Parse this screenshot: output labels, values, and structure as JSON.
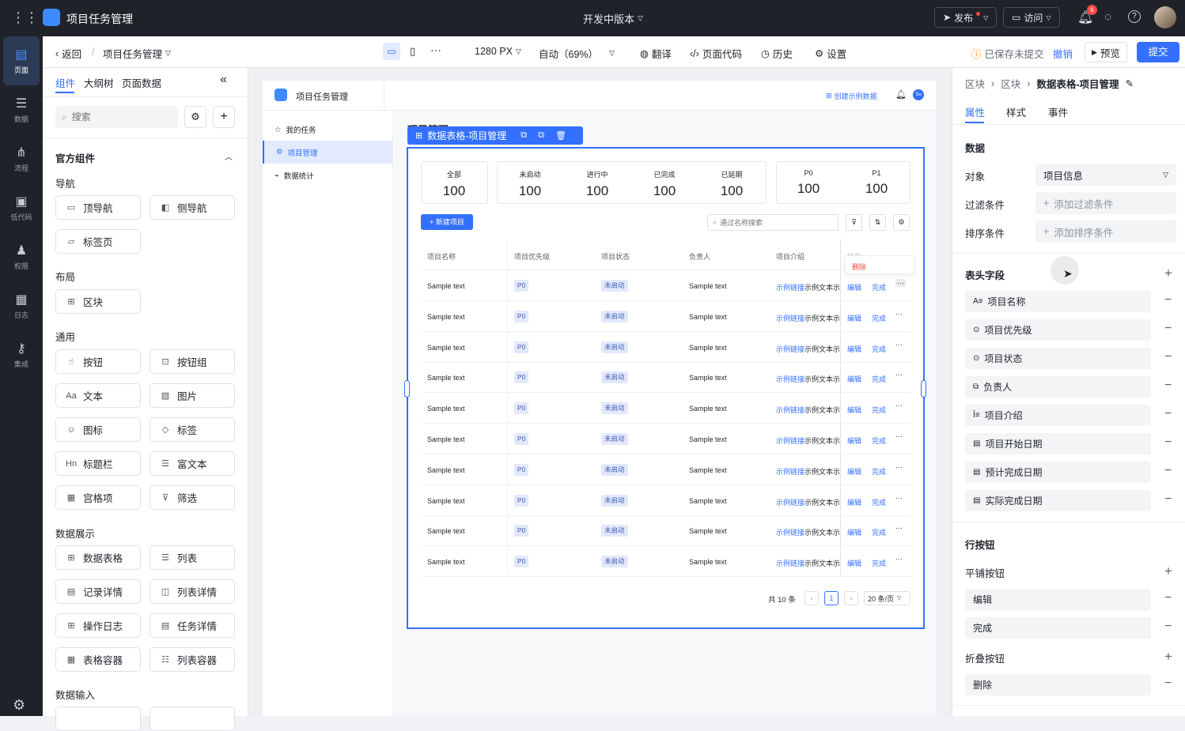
{
  "topbar": {
    "app_title": "项目任务管理",
    "version": "开发中版本",
    "publish": "发布",
    "visit": "访问",
    "notif_count": "6"
  },
  "rail": [
    {
      "label": "页面",
      "icon": "pages-icon"
    },
    {
      "label": "数据",
      "icon": "database-icon"
    },
    {
      "label": "流程",
      "icon": "flow-icon"
    },
    {
      "label": "低代码",
      "icon": "code-icon"
    },
    {
      "label": "权限",
      "icon": "users-icon"
    },
    {
      "label": "日志",
      "icon": "log-icon"
    },
    {
      "label": "集成",
      "icon": "key-icon"
    }
  ],
  "toolbar": {
    "back": "返回",
    "page_name": "项目任务管理",
    "width": "1280 PX",
    "zoom": "自动（69%）",
    "translate": "翻译",
    "page_code": "页面代码",
    "history": "历史",
    "settings": "设置",
    "save_status": "已保存未提交",
    "undo": "撤销",
    "preview": "预览",
    "submit": "提交"
  },
  "left": {
    "tabs": [
      "组件",
      "大纲树",
      "页面数据"
    ],
    "search_placeholder": "搜索",
    "official": "官方组件",
    "sections": {
      "nav": "导航",
      "layout": "布局",
      "common": "通用",
      "display": "数据展示",
      "input": "数据输入"
    },
    "nav_items": [
      "顶导航",
      "侧导航",
      "标签页"
    ],
    "layout_items": [
      "区块"
    ],
    "common_items": [
      "按钮",
      "按钮组",
      "文本",
      "图片",
      "图标",
      "标签",
      "标题栏",
      "富文本",
      "宫格项",
      "筛选"
    ],
    "display_items": [
      "数据表格",
      "列表",
      "记录详情",
      "列表详情",
      "操作日志",
      "任务详情",
      "表格容器",
      "列表容器"
    ]
  },
  "app": {
    "title": "项目任务管理",
    "create_sample": "创建示例数据",
    "avatar": "Su",
    "nav": [
      "我的任务",
      "项目管理",
      "数据统计"
    ],
    "page_heading": "项目管理",
    "selected_label": "数据表格-项目管理",
    "stats": [
      {
        "label": "全部",
        "value": "100"
      },
      {
        "label": "未启动",
        "value": "100"
      },
      {
        "label": "进行中",
        "value": "100"
      },
      {
        "label": "已完成",
        "value": "100"
      },
      {
        "label": "已延期",
        "value": "100"
      },
      {
        "label": "P0",
        "value": "100"
      },
      {
        "label": "P1",
        "value": "100"
      }
    ],
    "new_button": "+ 新建项目",
    "search_placeholder": "通过名称搜索",
    "columns": [
      "项目名称",
      "项目优先级",
      "项目状态",
      "负责人",
      "项目介绍",
      "操作"
    ],
    "row": {
      "name": "Sample text",
      "priority": "P0",
      "status": "未启动",
      "owner": "Sample text",
      "intro_link": "示例链接",
      "intro_text": "示例文本示",
      "edit": "编辑",
      "done": "完成"
    },
    "row_count": 10,
    "delete_popup": "删除",
    "pagination": {
      "total": "共 10 条",
      "page": "1",
      "per_page": "20 条/页"
    }
  },
  "right": {
    "breadcrumb": [
      "区块",
      "区块",
      "数据表格-项目管理"
    ],
    "tabs": [
      "属性",
      "样式",
      "事件"
    ],
    "data_title": "数据",
    "object_label": "对象",
    "object_value": "项目信息",
    "filter_label": "过滤条件",
    "filter_add": "添加过滤条件",
    "sort_label": "排序条件",
    "sort_add": "添加排序条件",
    "header_fields_title": "表头字段",
    "fields": [
      {
        "label": "项目名称",
        "icon": "text-field-icon"
      },
      {
        "label": "项目优先级",
        "icon": "select-icon"
      },
      {
        "label": "项目状态",
        "icon": "select-icon"
      },
      {
        "label": "负责人",
        "icon": "user-icon"
      },
      {
        "label": "项目介绍",
        "icon": "multiline-icon"
      },
      {
        "label": "项目开始日期",
        "icon": "calendar-icon"
      },
      {
        "label": "预计完成日期",
        "icon": "calendar-icon"
      },
      {
        "label": "实际完成日期",
        "icon": "calendar-icon"
      }
    ],
    "row_buttons_title": "行按钮",
    "tiled_label": "平铺按钮",
    "tiled": [
      "编辑",
      "完成"
    ],
    "folded_label": "折叠按钮",
    "folded": [
      "删除"
    ]
  }
}
